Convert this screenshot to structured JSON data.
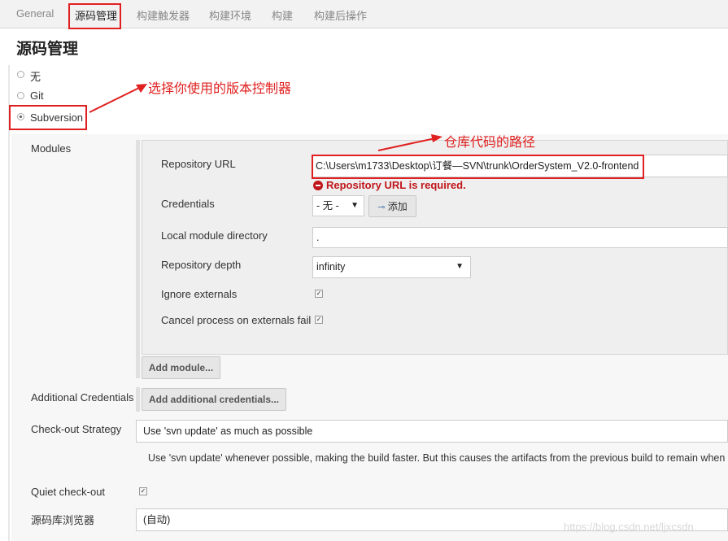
{
  "tabs": [
    "General",
    "源码管理",
    "构建触发器",
    "构建环境",
    "构建",
    "构建后操作"
  ],
  "page_title": "源码管理",
  "scm_options": [
    "无",
    "Git",
    "Subversion"
  ],
  "selected_scm": "Subversion",
  "annotations": {
    "version_control": "选择你使用的版本控制器",
    "repo_path": "仓库代码的路径"
  },
  "modules": {
    "section_label": "Modules",
    "repository_url_label": "Repository URL",
    "repository_url_value": "C:\\Users\\m1733\\Desktop\\订餐—SVN\\trunk\\OrderSystem_V2.0-frontend",
    "error": "Repository URL is required.",
    "credentials_label": "Credentials",
    "credentials_value": "- 无 -",
    "add_button": "添加",
    "local_dir_label": "Local module directory",
    "local_dir_value": ".",
    "depth_label": "Repository depth",
    "depth_value": "infinity",
    "ignore_externals_label": "Ignore externals",
    "cancel_process_label": "Cancel process on externals fail",
    "add_module_button": "Add module..."
  },
  "additional_credentials": {
    "label": "Additional Credentials",
    "button": "Add additional credentials..."
  },
  "checkout_strategy": {
    "label": "Check-out Strategy",
    "value": "Use 'svn update' as much as possible",
    "description": "Use 'svn update' whenever possible, making the build faster. But this causes the artifacts from the previous build to remain when"
  },
  "quiet_checkout_label": "Quiet check-out",
  "repo_browser": {
    "label": "源码库浏览器",
    "value": "(自动)"
  },
  "watermark": "https://blog.csdn.net/ljxcsdn"
}
